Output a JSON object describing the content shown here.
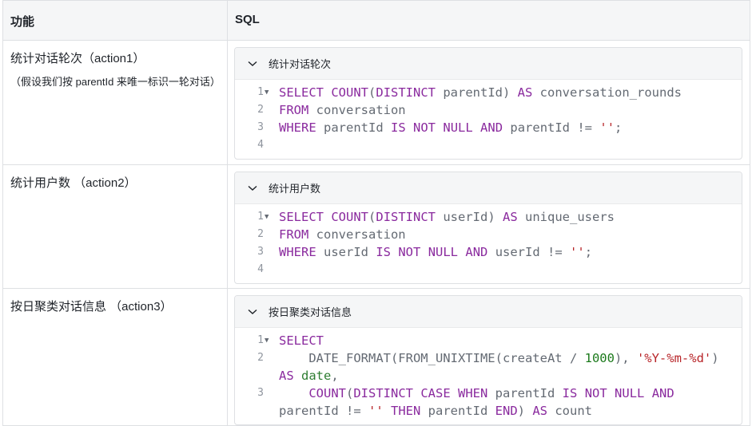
{
  "table": {
    "headers": [
      "功能",
      "SQL"
    ],
    "rows": [
      {
        "feature_title": "统计对话轮次（action1）",
        "feature_note": "（假设我们按 parentId 来唯一标识一轮对话）",
        "block_title": "统计对话轮次",
        "line_numbers": [
          "1",
          "2",
          "3",
          "4"
        ]
      },
      {
        "feature_title": "统计用户数 （action2）",
        "feature_note": "",
        "block_title": "统计用户数",
        "line_numbers": [
          "1",
          "2",
          "3",
          "4"
        ]
      },
      {
        "feature_title": "按日聚类对话信息 （action3）",
        "feature_note": "",
        "block_title": "按日聚类对话信息",
        "line_numbers": [
          "1",
          "2",
          "3"
        ]
      }
    ]
  },
  "code": {
    "r1": {
      "l1": [
        "SELECT",
        " ",
        "COUNT",
        "(",
        "DISTINCT",
        " parentId) ",
        "AS",
        " conversation_rounds"
      ],
      "l2": [
        "FROM",
        " conversation"
      ],
      "l3": [
        "WHERE",
        " parentId ",
        "IS",
        " ",
        "NOT",
        " ",
        "NULL",
        " ",
        "AND",
        " parentId != ",
        "''",
        ";"
      ]
    },
    "r2": {
      "l1": [
        "SELECT",
        " ",
        "COUNT",
        "(",
        "DISTINCT",
        " userId) ",
        "AS",
        " unique_users"
      ],
      "l2": [
        "FROM",
        " conversation"
      ],
      "l3": [
        "WHERE",
        " userId ",
        "IS",
        " ",
        "NOT",
        " ",
        "NULL",
        " ",
        "AND",
        " userId != ",
        "''",
        ";"
      ]
    },
    "r3": {
      "l1": [
        "SELECT"
      ],
      "l2": [
        "    DATE_FORMAT(FROM_UNIXTIME(createAt / ",
        "1000",
        "), ",
        "'%Y-%m-%d'",
        ")",
        "AS",
        " ",
        "date",
        ","
      ],
      "l3": [
        "    ",
        "COUNT",
        "(",
        "DISTINCT",
        " ",
        "CASE",
        " ",
        "WHEN",
        " parentId ",
        "IS",
        " ",
        "NOT",
        " ",
        "NULL",
        " ",
        "AND",
        "parentId != ",
        "''",
        " ",
        "THEN",
        " parentId ",
        "END",
        ") ",
        "AS",
        " count"
      ]
    }
  },
  "icons": {
    "collapse": "chevron-down-icon",
    "fold": "fold-triangle-icon"
  },
  "colors": {
    "keyword": "#8a2a9e",
    "string": "#b8262a",
    "number": "#1c7a1c",
    "plain": "#646a73"
  }
}
